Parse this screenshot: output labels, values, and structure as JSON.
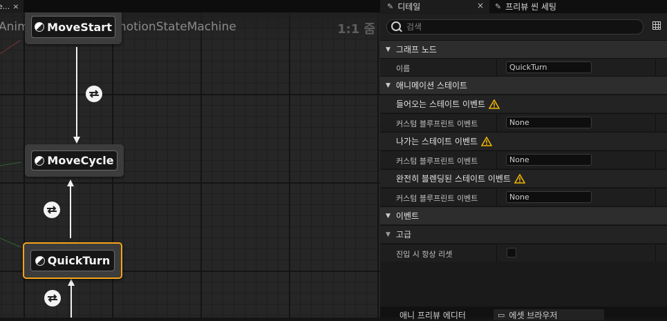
{
  "graph": {
    "tab_label": "e...",
    "tab_close": "×",
    "breadcrumb": [
      "AnimGraph",
      "LocomotionStateMachine"
    ],
    "breadcrumb_sep": "〉",
    "zoom": "1:1 줌",
    "nodes": [
      {
        "title": "MoveStart",
        "selected": false
      },
      {
        "title": "MoveCycle",
        "selected": false
      },
      {
        "title": "QuickTurn",
        "selected": true
      }
    ],
    "colors": {
      "selected_border": "#f7a416",
      "transition": "#f3f3f3"
    }
  },
  "details": {
    "tabs": [
      {
        "label": "디테일",
        "icon": "pencil-icon",
        "close": "×",
        "active": true
      },
      {
        "label": "프리뷰 씬 세팅",
        "icon": "pencil-icon",
        "active": false
      }
    ],
    "search": {
      "placeholder": "검색",
      "value": ""
    },
    "sections": {
      "graph_node": {
        "title": "그래프 노드",
        "name_label": "이름",
        "name_value": "QuickTurn"
      },
      "anim_state": {
        "title": "애니메이션 스테이트",
        "entered_event": "들어오는 스테이트 이벤트",
        "entered_custom_label": "커스텀 블루프린트 이벤트",
        "entered_custom_value": "None",
        "left_event": "나가는 스테이트 이벤트",
        "left_custom_label": "커스텀 블루프린트 이벤트",
        "left_custom_value": "None",
        "fully_blended_event": "완전히 블렌딩된 스테이트 이벤트",
        "fully_blended_custom_label": "커스텀 블루프린트 이벤트",
        "fully_blended_custom_value": "None"
      },
      "events": {
        "title": "이벤트"
      },
      "advanced": {
        "title": "고급",
        "reset_label": "진입 시 항상 리셋",
        "reset_checked": false
      }
    }
  },
  "bottom_tabs": [
    {
      "label": "애니 프리뷰 에디터",
      "active": false
    },
    {
      "label": "에셋 브라우저",
      "icon": "folder-icon",
      "active": true
    }
  ]
}
